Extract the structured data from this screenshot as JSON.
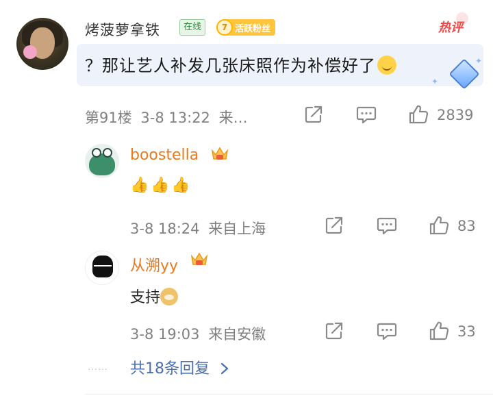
{
  "main_comment": {
    "author": "烤菠萝拿铁",
    "online_badge": "在线",
    "fan_level": "7",
    "fan_badge": "活跃粉丝",
    "hot_tag": "热评",
    "text": "？那让艺人补发几张床照作为补偿好了",
    "floor": "第91楼",
    "datetime": "3-8 13:22",
    "location_truncated": "来…",
    "likes": "2839"
  },
  "replies": [
    {
      "author": "boostella",
      "date": "3-8 18:24",
      "location": "来自上海",
      "likes": "83",
      "emojis": [
        "thumbs-up",
        "thumbs-up",
        "thumbs-up"
      ]
    },
    {
      "author": "从溯yy",
      "text": "支持",
      "date": "3-8 19:03",
      "location": "来自安徽",
      "likes": "33"
    }
  ],
  "more": {
    "dots": "……",
    "label": "共18条回复"
  },
  "colors": {
    "reply_name": "#e87a1e",
    "link": "#4a6fb0",
    "meta_gray": "#808080",
    "hot_red": "#f04848",
    "fan_badge": "#ffc53d"
  }
}
